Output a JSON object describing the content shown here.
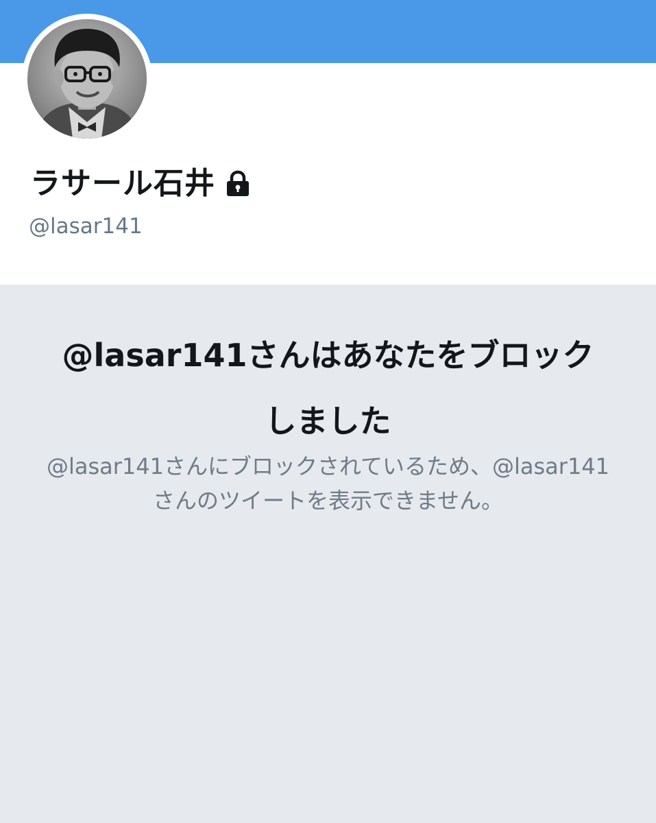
{
  "profile": {
    "display_name": "ラサール石井",
    "handle": "@lasar141",
    "protected_icon": "lock-icon",
    "avatar_alt": "profile-photo"
  },
  "blocked": {
    "title": "@lasar141さんはあなたをブロックしました",
    "description": "@lasar141さんにブロックされているため、@lasar141さんのツイートを表示できません。"
  },
  "colors": {
    "banner": "#4a99e9",
    "panel_background": "#e6e9ee",
    "primary_text": "#14171a",
    "secondary_text": "#657786"
  }
}
